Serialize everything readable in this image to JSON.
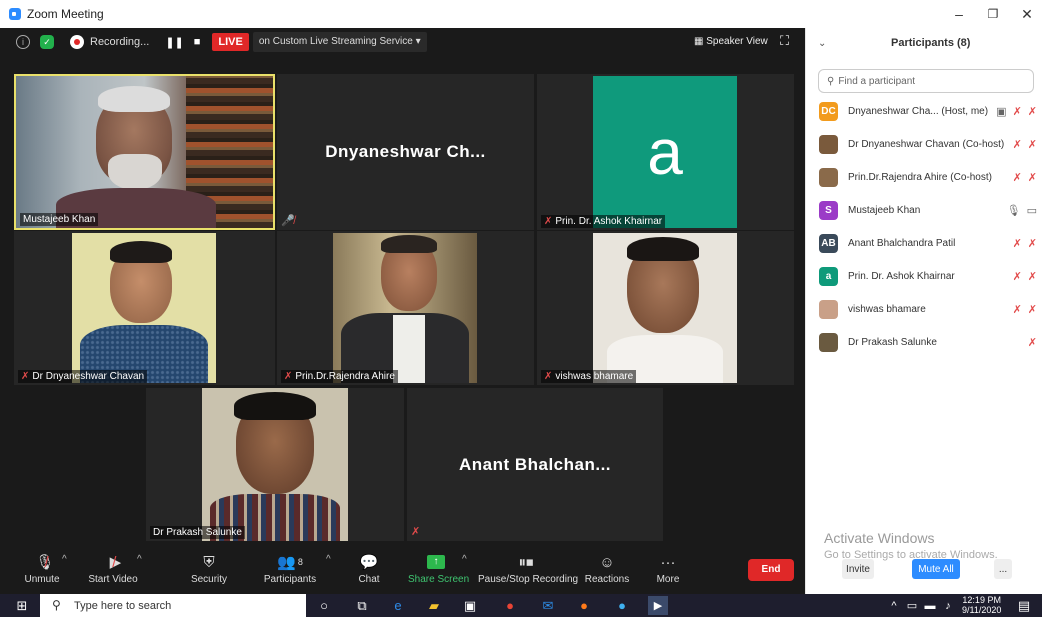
{
  "window": {
    "title": "Zoom Meeting",
    "minimize": "–",
    "restore": "❐",
    "close": "✕"
  },
  "topbar": {
    "recording": "Recording...",
    "live": "LIVE",
    "stream": "on Custom Live Streaming Service",
    "view": "Speaker View"
  },
  "tiles": [
    {
      "name": "Mustajeeb Khan"
    },
    {
      "name": "",
      "display": "Dnyaneshwar  Ch..."
    },
    {
      "name": "Prin. Dr. Ashok Khairnar",
      "letter": "a"
    },
    {
      "name": "Dr Dnyaneshwar Chavan"
    },
    {
      "name": "Prin.Dr.Rajendra Ahire"
    },
    {
      "name": "vishwas bhamare"
    },
    {
      "name": "Dr Prakash Salunke"
    },
    {
      "name": "",
      "display": "Anant  Bhalchan..."
    }
  ],
  "toolbar": {
    "unmute": "Unmute",
    "start_video": "Start Video",
    "security": "Security",
    "participants": "Participants",
    "participants_count": "8",
    "chat": "Chat",
    "share": "Share Screen",
    "pause": "Pause/Stop Recording",
    "reactions": "Reactions",
    "more": "More",
    "end": "End"
  },
  "panel": {
    "title": "Participants (8)",
    "search_placeholder": "Find a participant",
    "participants": [
      {
        "name": "Dnyaneshwar Cha...  (Host, me)",
        "avatar_text": "DC",
        "avatar_color": "#f29b1d"
      },
      {
        "name": "Dr Dnyaneshwar Chavan (Co-host)",
        "avatar_text": "",
        "avatar_color": "#7a5a3c"
      },
      {
        "name": "Prin.Dr.Rajendra Ahire (Co-host)",
        "avatar_text": "",
        "avatar_color": "#8a6a4a"
      },
      {
        "name": "Mustajeeb Khan",
        "avatar_text": "S",
        "avatar_color": "#9b3bc7"
      },
      {
        "name": "Anant  Bhalchandra Patil",
        "avatar_text": "AB",
        "avatar_color": "#3a4a5a"
      },
      {
        "name": "Prin. Dr. Ashok Khairnar",
        "avatar_text": "a",
        "avatar_color": "#0e9a7a"
      },
      {
        "name": "vishwas bhamare",
        "avatar_text": "",
        "avatar_color": "#c9a088"
      },
      {
        "name": "Dr Prakash Salunke",
        "avatar_text": "",
        "avatar_color": "#6a5a40"
      }
    ],
    "watermark_title": "Activate Windows",
    "watermark_sub": "Go to Settings to activate Windows.",
    "invite": "Invite",
    "mute_all": "Mute All",
    "more": "..."
  },
  "taskbar": {
    "search": "Type here to search",
    "time": "12:19 PM",
    "date": "9/11/2020"
  }
}
